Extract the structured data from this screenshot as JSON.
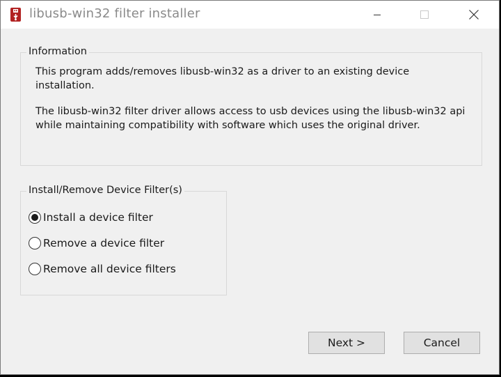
{
  "window": {
    "title": "libusb-win32 filter installer"
  },
  "info": {
    "legend": "Information",
    "line1a": "This program adds/removes libusb-win32 as a driver to an existing device",
    "line1b": "installation.",
    "line2a": "The libusb-win32 filter driver allows access to usb devices using the libusb-win32 api",
    "line2b": "while maintaining compatibility with software which uses the original driver."
  },
  "filter": {
    "legend": "Install/Remove Device Filter(s)",
    "options": [
      {
        "label": "Install a device filter",
        "selected": true
      },
      {
        "label": "Remove a device filter",
        "selected": false
      },
      {
        "label": "Remove all device filters",
        "selected": false
      }
    ]
  },
  "buttons": {
    "next": "Next >",
    "cancel": "Cancel"
  },
  "icons": {
    "app": "usb-driver-icon",
    "minimize": "minimize-icon",
    "maximize": "maximize-icon",
    "close": "close-icon"
  },
  "colors": {
    "titlebar": "#ffffff",
    "body": "#f0f0f0",
    "title_text": "#8a8a8a",
    "button_face": "#e1e1e1",
    "app_icon": "#b22222"
  }
}
